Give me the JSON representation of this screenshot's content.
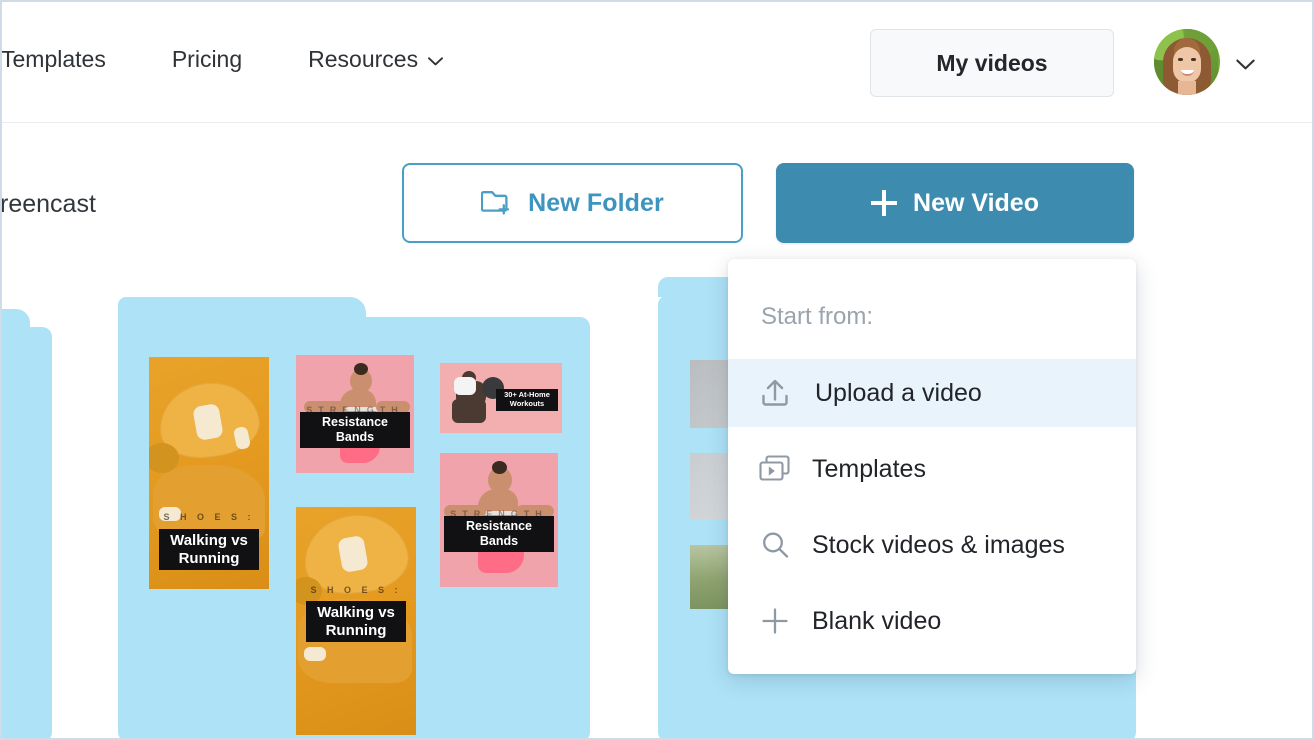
{
  "window": {
    "frame_border_color": "#cfdce8",
    "background": "#ffffff"
  },
  "header": {
    "nav_items": [
      {
        "label": "Templates",
        "icon": ""
      },
      {
        "label": "Pricing",
        "icon": ""
      },
      {
        "label": "Resources",
        "icon": "chevron-down-icon"
      }
    ],
    "my_videos_label": "My videos",
    "avatar_alt": "user-avatar",
    "account_chevron": "chevron-down-icon"
  },
  "toolbar": {
    "breadcrumb": "reencast",
    "new_folder_label": "New Folder",
    "new_folder_icon": "folder-plus-icon",
    "new_video_label": "New Video",
    "new_video_icon": "plus-icon",
    "accent_blue": "#3d8cb0",
    "outline_blue": "#4a9fc6"
  },
  "dropdown": {
    "title": "Start from:",
    "highlight_color": "#e9f3fb",
    "items": [
      {
        "label": "Upload a video",
        "icon": "upload-icon",
        "active": true
      },
      {
        "label": "Templates",
        "icon": "templates-stack-icon",
        "active": false
      },
      {
        "label": "Stock videos & images",
        "icon": "search-icon",
        "active": false
      },
      {
        "label": "Blank video",
        "icon": "plus-icon",
        "active": false
      }
    ]
  },
  "folders": {
    "card_color": "#ade2f7",
    "items": [
      {
        "name": "folder-partial-left",
        "thumbnails": [
          {
            "name": "lime-food-thumbnail",
            "caption": "",
            "kicker": ""
          }
        ]
      },
      {
        "name": "folder-fitness",
        "thumbnails": [
          {
            "name": "shoes-portrait-thumbnail",
            "kicker": "S H O E S :",
            "caption": "Walking vs Running"
          },
          {
            "name": "resistance-bands-thumbnail-small",
            "kicker": "STRENGTH",
            "caption": "Resistance Bands"
          },
          {
            "name": "at-home-workouts-thumbnail",
            "kicker": "",
            "caption": "30+ At-Home Workouts"
          },
          {
            "name": "resistance-bands-thumbnail-large",
            "kicker": "STRENGTH",
            "caption": "Resistance Bands"
          },
          {
            "name": "shoes-portrait-thumbnail-2",
            "kicker": "S H O E S :",
            "caption": "Walking vs Running"
          }
        ]
      },
      {
        "name": "folder-partial-right",
        "thumbnails": [
          {
            "name": "grey-thumbnail-1",
            "caption": "",
            "kicker": ""
          },
          {
            "name": "grey-thumbnail-2",
            "caption": "",
            "kicker": ""
          },
          {
            "name": "outdoor-thumbnail",
            "caption": "",
            "kicker": ""
          }
        ]
      }
    ]
  }
}
